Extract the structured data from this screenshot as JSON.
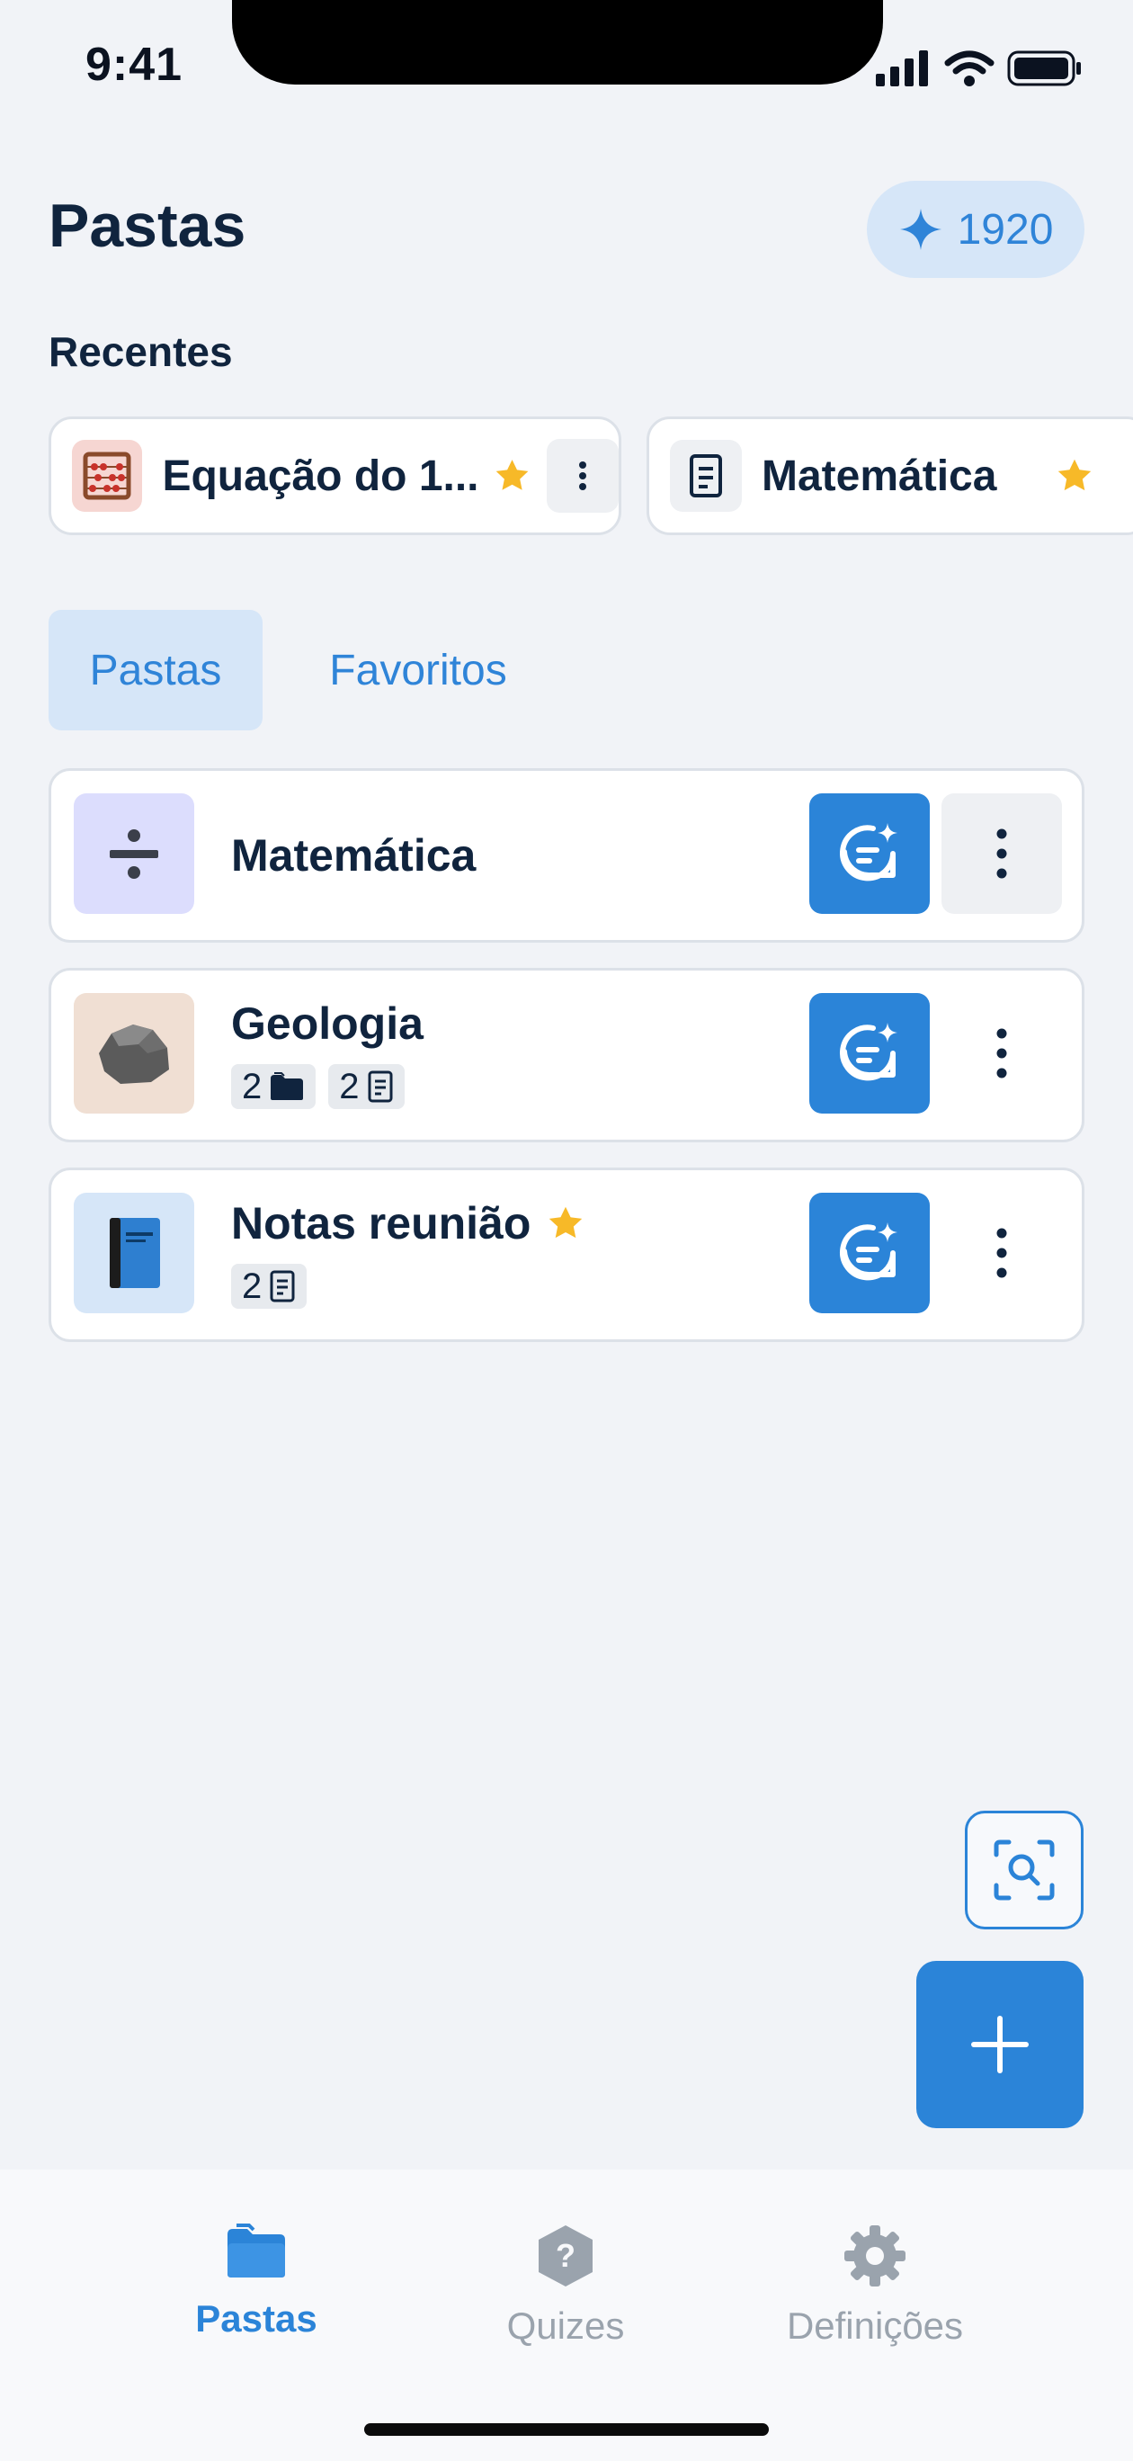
{
  "status": {
    "time": "9:41"
  },
  "header": {
    "title": "Pastas",
    "coins": "1920"
  },
  "recent": {
    "heading": "Recentes",
    "items": [
      {
        "label": "Equação do 1...",
        "favorite": true
      },
      {
        "label": "Matemática",
        "favorite": true
      }
    ]
  },
  "tabs": [
    {
      "label": "Pastas",
      "active": true
    },
    {
      "label": "Favoritos",
      "active": false
    }
  ],
  "folders": [
    {
      "name": "Matemática",
      "favorite": false,
      "folders_count": null,
      "notes_count": null
    },
    {
      "name": "Geologia",
      "favorite": false,
      "folders_count": "2",
      "notes_count": "2"
    },
    {
      "name": "Notas reunião",
      "favorite": true,
      "folders_count": null,
      "notes_count": "2"
    }
  ],
  "nav": {
    "items": [
      {
        "label": "Pastas",
        "icon": "folder-icon",
        "active": true
      },
      {
        "label": "Quizes",
        "icon": "quiz-icon",
        "active": false
      },
      {
        "label": "Definições",
        "icon": "gear-icon",
        "active": false
      }
    ]
  },
  "colors": {
    "accent": "#2B84D8",
    "text": "#10243E",
    "star": "#F7B928",
    "inactive": "#9AA3AD"
  }
}
